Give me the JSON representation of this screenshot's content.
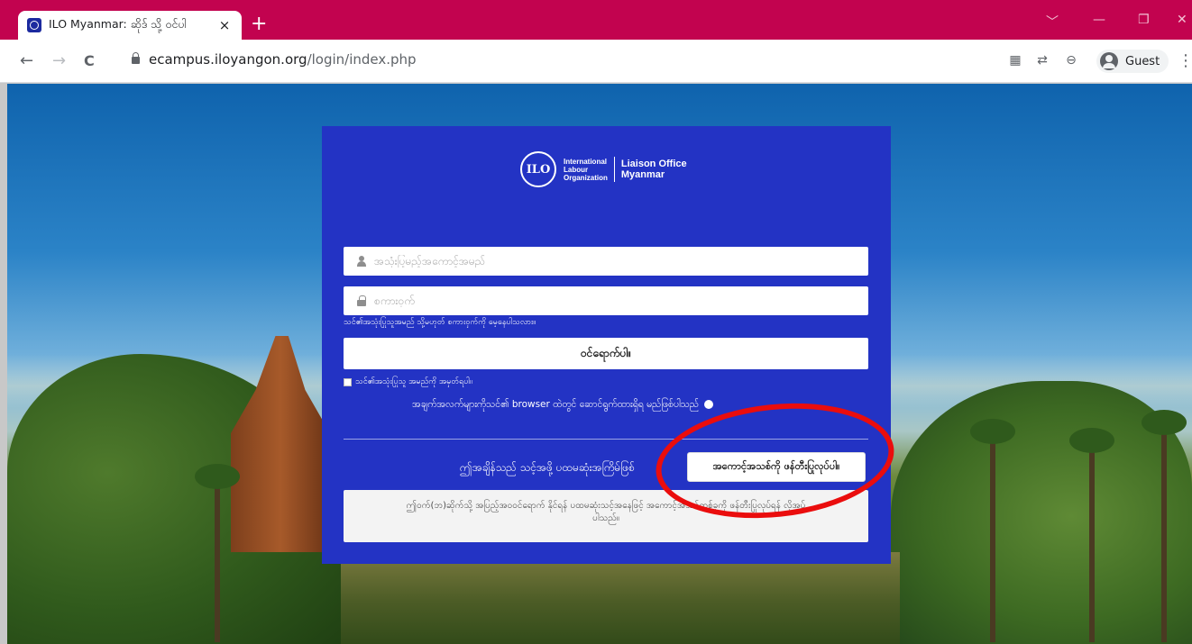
{
  "browser": {
    "tab_title": "ILO Myanmar: ဆိုဒ် သို့ ဝင်ပါ",
    "tab_close": "×",
    "new_tab": "+",
    "url_host": "ecampus.iloyangon.org",
    "url_path": "/login/index.php",
    "profile_label": "Guest",
    "back_icon": "←",
    "forward_icon": "→",
    "reload_icon": "C",
    "menu_icon": "⋮",
    "window_controls": [
      "﹀",
      "—",
      "❐",
      "✕"
    ]
  },
  "logo": {
    "emblem_text": "ILO",
    "org_lines": [
      "International",
      "Labour",
      "Organization"
    ],
    "office_lines": [
      "Liaison Office",
      "Myanmar"
    ]
  },
  "form": {
    "username_placeholder": "အသုံးပြုမည့်အကောင့်အမည်",
    "password_placeholder": "စကားဝှက်",
    "forgot_text": "သင်၏အသုံးပြုသူအမည် သို့မဟုတ် စကားဝှက်ကို မေ့နေပါသလား။",
    "login_button": "ဝင်ရောက်ပါ။",
    "remember_label": "သင်၏အသုံးပြုသူ အမည်ကို အမှတ်ရပါ။",
    "cookies_text": "အချက်အလက်များကိုသင်၏ browser ထဲတွင် ဆောင်ရွက်ထားရှိရ မည်ဖြစ်ပါသည်"
  },
  "signup": {
    "first_time_text": "ဤအချိန်သည် သင့်အဖို့ ပထမဆုံးအကြိမ်ဖြစ်",
    "create_button": "အကောင့်အသစ်ကို ဖန်တီးပြုလုပ်ပါ။",
    "info_text": "ဤဝက်(ဘ)ဆိုက်သို့ အပြည့်အဝဝင်ရောက် နိုင်ရန် ပထမဆုံးသင့်အနေဖြင့် အကောင့်အသစ်တစ်ခုကို ဖန်တီးပြုလုပ်ရန် လိုအပ်ပါသည်။"
  },
  "colors": {
    "chrome_accent": "#c2034f",
    "card_background": "#2333c4",
    "annotation_ring": "#ea0d0d"
  }
}
